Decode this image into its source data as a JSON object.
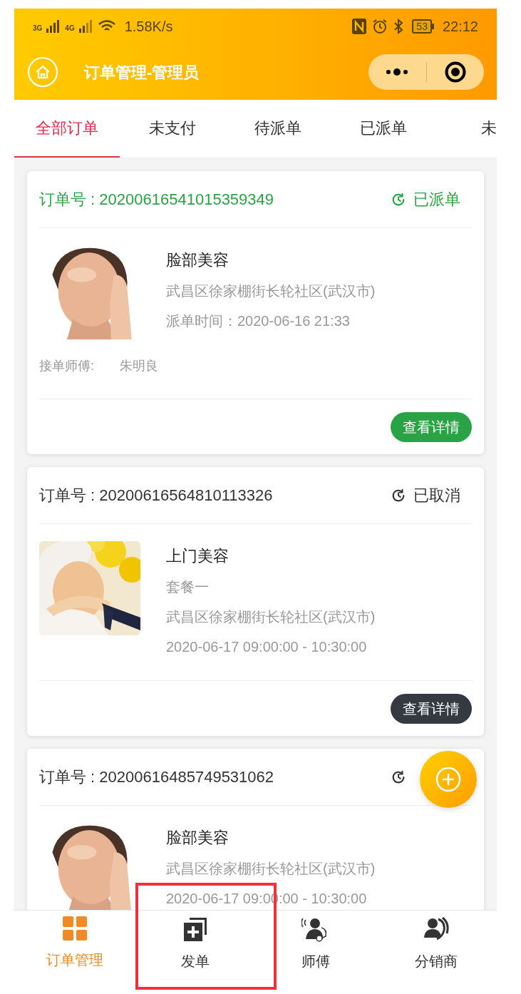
{
  "status_bar": {
    "network_1": "3G",
    "network_2": "4G",
    "speed": "1.58K/s",
    "battery": "53",
    "time": "22:12"
  },
  "header": {
    "title": "订单管理-管理员"
  },
  "tabs": [
    {
      "label": "全部订单",
      "selected": true
    },
    {
      "label": "未支付",
      "selected": false
    },
    {
      "label": "待派单",
      "selected": false
    },
    {
      "label": "已派单",
      "selected": false
    },
    {
      "label": "未",
      "selected": false
    }
  ],
  "orders": [
    {
      "number": "订单号 : 20200616541015359349",
      "status": "已派单",
      "kind": "dispatched",
      "title": "脸部美容",
      "lines": [
        "武昌区徐家棚街长轮社区(武汉市)",
        "派单时间：2020-06-16 21:33"
      ],
      "master_label": "接单师傅:",
      "master": "朱明良",
      "button": "查看详情"
    },
    {
      "number": "订单号 : 20200616564810113326",
      "status": "已取消",
      "kind": "cancelled",
      "title": "上门美容",
      "lines": [
        "套餐一",
        "武昌区徐家棚街长轮社区(武汉市)",
        "2020-06-17 09:00:00 - 10:30:00"
      ],
      "button": "查看详情"
    },
    {
      "number": "订单号 : 20200616485749531062",
      "kind": "cancelled",
      "title": "脸部美容",
      "lines": [
        "武昌区徐家棚街长轮社区(武汉市)",
        "2020-06-17 09:00:00 - 10:30:00"
      ]
    }
  ],
  "nav": [
    {
      "label": "订单管理",
      "selected": true,
      "highlighted": false
    },
    {
      "label": "发单",
      "selected": false,
      "highlighted": true
    },
    {
      "label": "师傅",
      "selected": false,
      "highlighted": false
    },
    {
      "label": "分销商",
      "selected": false,
      "highlighted": false
    }
  ]
}
